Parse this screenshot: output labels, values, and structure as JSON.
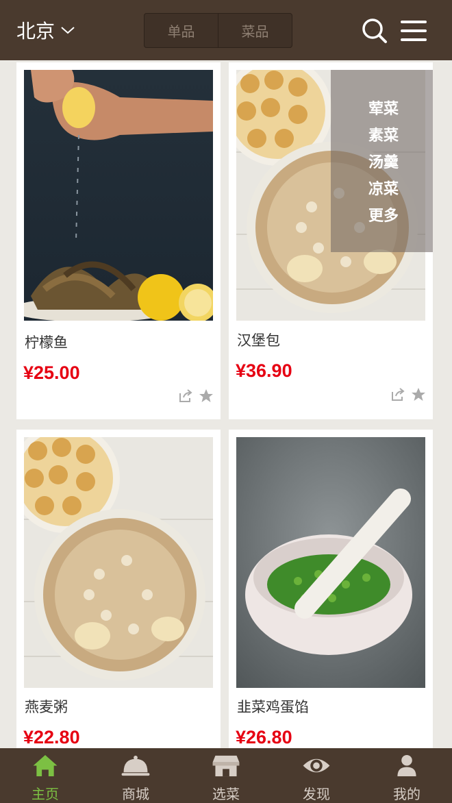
{
  "header": {
    "city": "北京",
    "segments": [
      "单品",
      "菜品"
    ]
  },
  "categories": [
    "荤菜",
    "素菜",
    "汤羹",
    "凉菜",
    "更多"
  ],
  "products": [
    {
      "name": "柠檬鱼",
      "price": "¥25.00"
    },
    {
      "name": "汉堡包",
      "price": "¥36.90"
    },
    {
      "name": "燕麦粥",
      "price": "¥22.80"
    },
    {
      "name": "韭菜鸡蛋馅",
      "price": "¥26.80"
    }
  ],
  "tabs": [
    {
      "label": "主页",
      "icon": "home-icon"
    },
    {
      "label": "商城",
      "icon": "cloche-icon"
    },
    {
      "label": "选菜",
      "icon": "store-icon"
    },
    {
      "label": "发现",
      "icon": "eye-icon"
    },
    {
      "label": "我的",
      "icon": "user-icon"
    }
  ],
  "colors": {
    "header": "#4a3a2e",
    "price": "#e60012",
    "active_tab": "#7cc043",
    "background": "#ebe9e4"
  }
}
